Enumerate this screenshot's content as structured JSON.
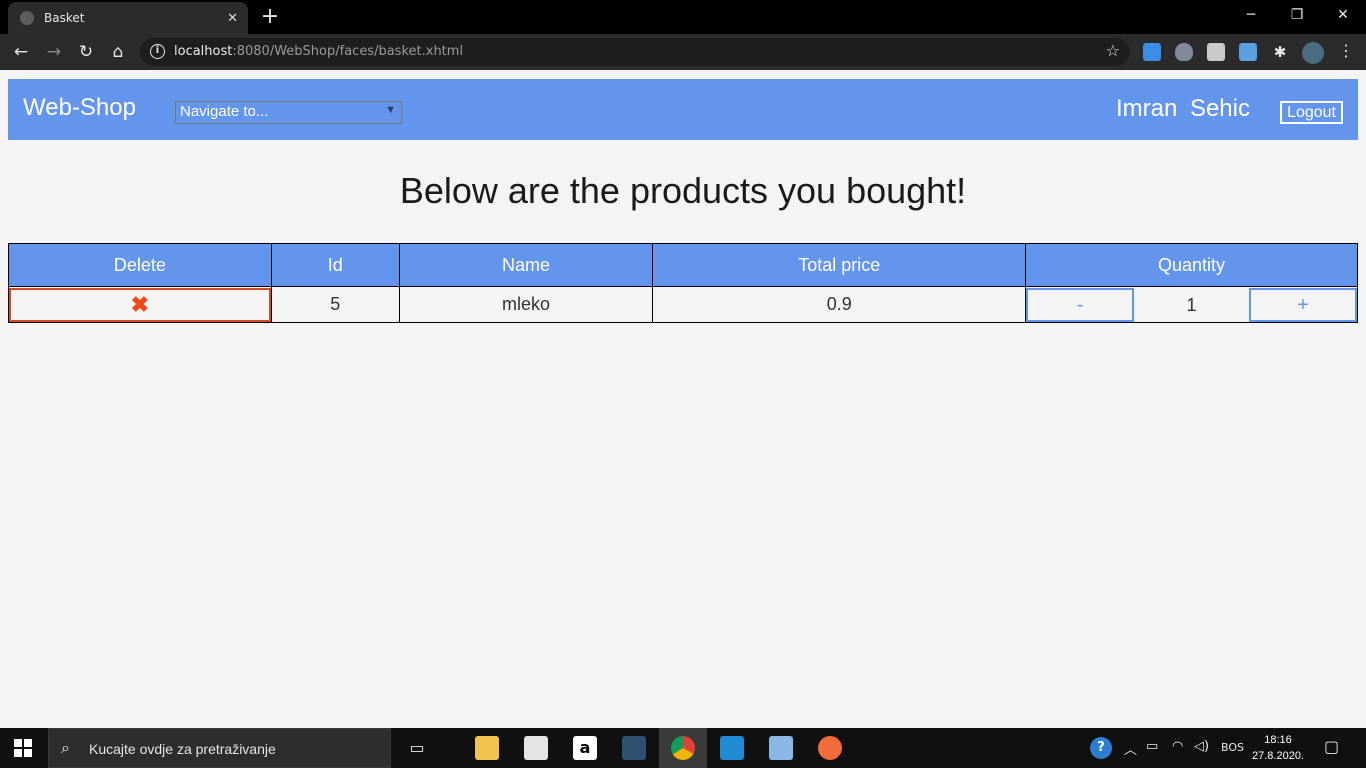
{
  "browser": {
    "tab_title": "Basket",
    "url_host": "localhost",
    "url_path": ":8080/WebShop/faces/basket.xhtml"
  },
  "navbar": {
    "brand": "Web-Shop",
    "select_value": "Navigate to...",
    "user_name": "Imran Sehic",
    "logout_label": "Logout"
  },
  "heading": "Below are the products you bought!",
  "table": {
    "headers": [
      "Delete",
      "Id",
      "Name",
      "Total price",
      "Quantity"
    ],
    "rows": [
      {
        "delete_icon": "✖",
        "id": "5",
        "name": "mleko",
        "total_price": "0.9",
        "decrement": "-",
        "quantity": "1",
        "increment": "+"
      }
    ]
  },
  "taskbar": {
    "search_placeholder": "Kucajte ovdje za pretraživanje",
    "language": "BOS",
    "time": "18:16",
    "date": "27.8.2020."
  },
  "colors": {
    "accent": "#6495ed",
    "delete": "#f04a1a"
  }
}
